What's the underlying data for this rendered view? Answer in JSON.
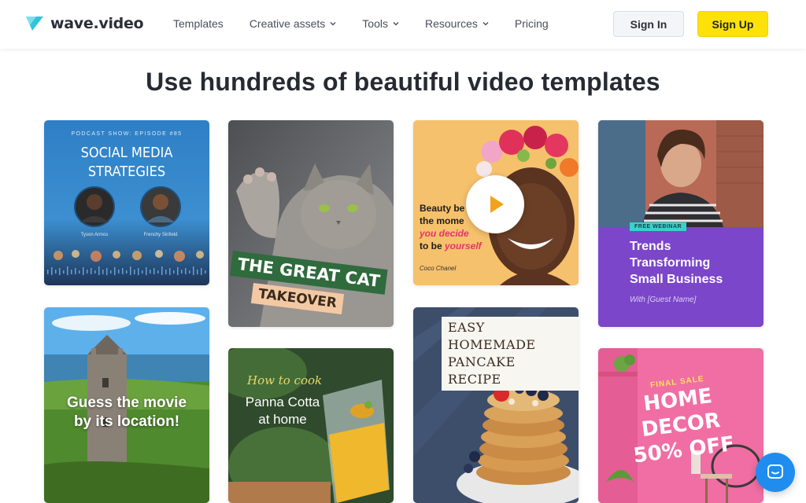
{
  "brand": {
    "name": "wave.video"
  },
  "nav": [
    {
      "label": "Templates",
      "dropdown": false
    },
    {
      "label": "Creative assets",
      "dropdown": true
    },
    {
      "label": "Tools",
      "dropdown": true
    },
    {
      "label": "Resources",
      "dropdown": true
    },
    {
      "label": "Pricing",
      "dropdown": false
    }
  ],
  "auth": {
    "signin": "Sign In",
    "signup": "Sign Up"
  },
  "headline": "Use hundreds of beautiful video templates",
  "templates": {
    "podcast": {
      "episode": "PODCAST SHOW: EPISODE #85",
      "title_line1": "SOCIAL MEDIA",
      "title_line2": "STRATEGIES",
      "host1": "Tyson Armos",
      "host2": "Frenchy Sinfield"
    },
    "cat": {
      "line1": "THE GREAT CAT",
      "line2": "TAKEOVER"
    },
    "beauty": {
      "line1": "Beauty be",
      "line2": "the mome",
      "line3": "you decide",
      "line4_a": "to be ",
      "line4_b": "yourself",
      "author": "Coco Chanel"
    },
    "webinar": {
      "badge": "FREE WEBINAR",
      "line1": "Trends",
      "line2": "Transforming",
      "line3": "Small Business",
      "with": "With [Guest Name]"
    },
    "castle": {
      "line1": "Guess the movie",
      "line2": "by its location!"
    },
    "panna": {
      "how": "How to cook",
      "line1": "Panna Cotta",
      "line2": "at home"
    },
    "pancake": {
      "line1": "EASY HOMEMADE",
      "line2": "PANCAKE RECIPE"
    },
    "decor": {
      "sale": "FINAL SALE",
      "line1": "HOME DECOR",
      "line2": "50% OFF"
    }
  },
  "colors": {
    "accent_yellow": "#ffe10a",
    "chat_blue": "#1f8df0",
    "webinar_purple": "#7b46c9"
  }
}
